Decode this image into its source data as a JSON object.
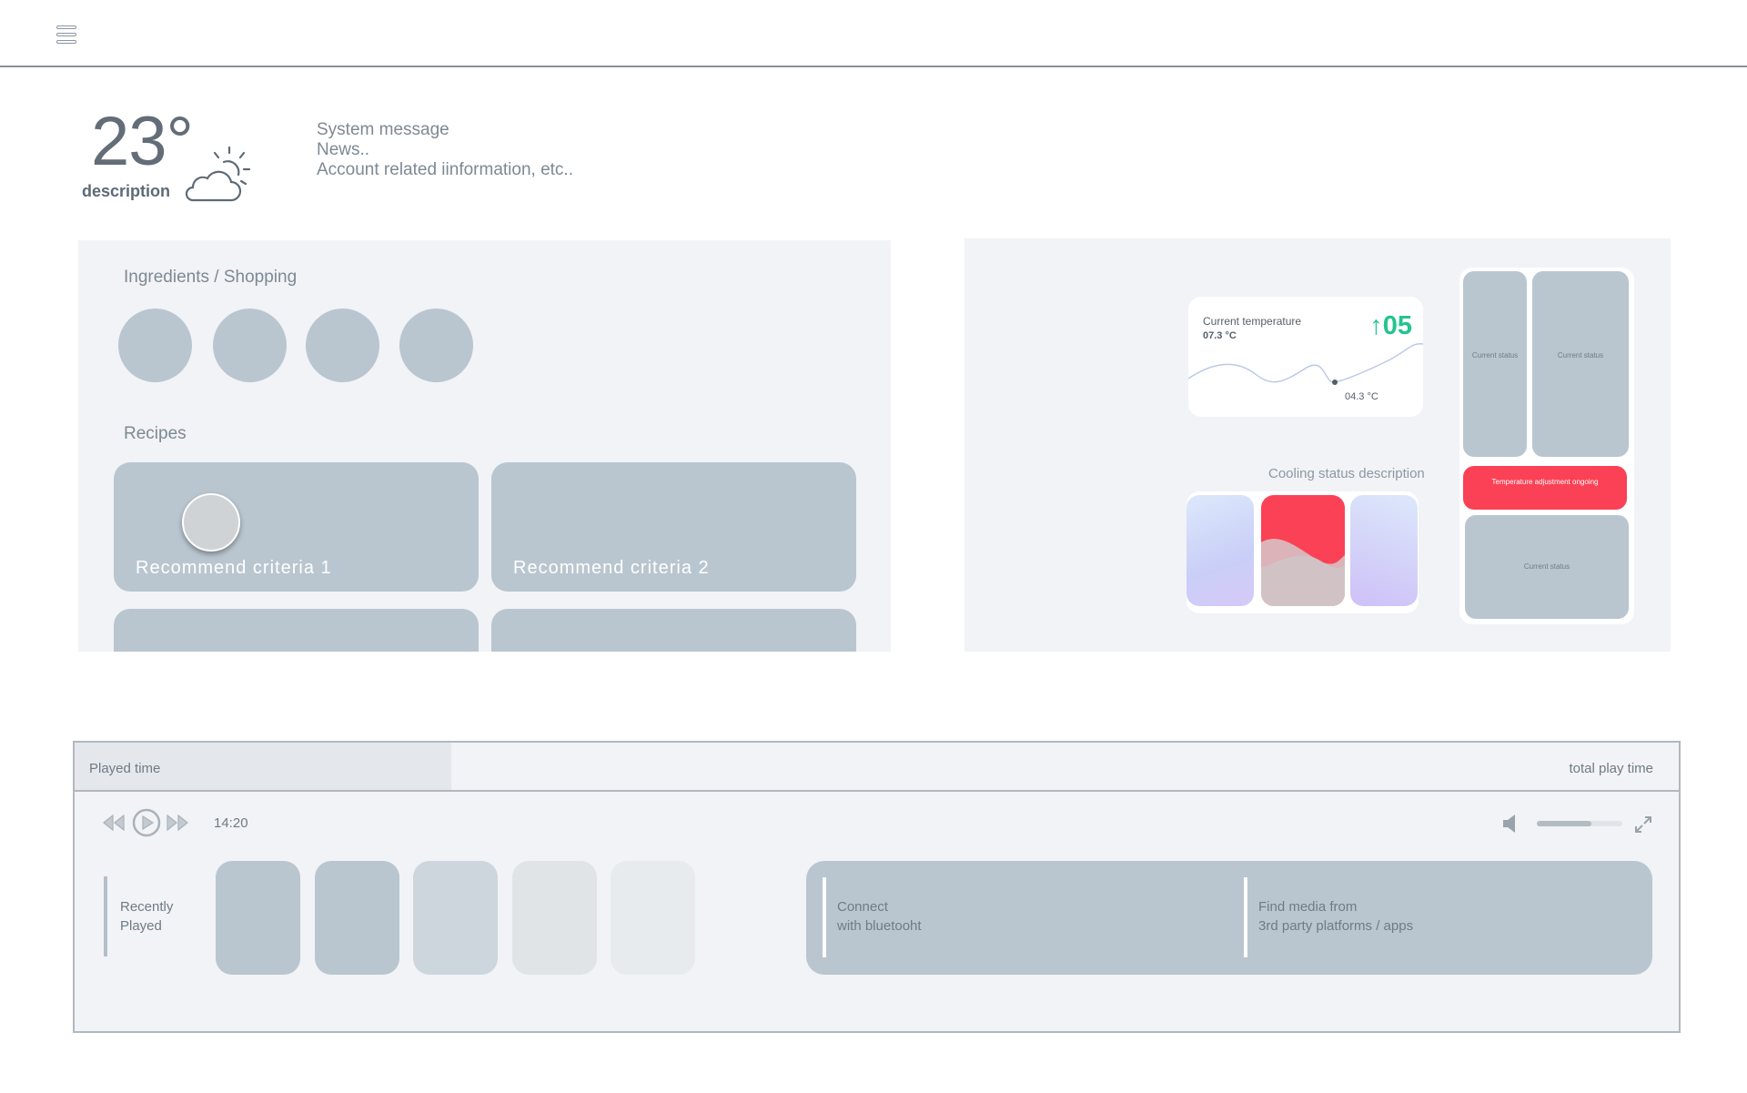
{
  "weather": {
    "temperature": "23°",
    "description": "description",
    "icon": "partly-cloudy-icon"
  },
  "messages": {
    "line1": "System message",
    "line2": "News..",
    "line3": "Account related iinformation, etc.."
  },
  "kitchen": {
    "ingredients_title": "Ingredients / Shopping",
    "recipes_title": "Recipes",
    "recipes": [
      {
        "label": "Recommend criteria 1"
      },
      {
        "label": "Recommend criteria 2"
      },
      {
        "label": ""
      },
      {
        "label": ""
      }
    ]
  },
  "fridge": {
    "temp_card": {
      "title": "Current temperature",
      "current": "07.3 °C",
      "delta": "↑05",
      "low_point": "04.3 °C"
    },
    "cooling_title": "Cooling status description",
    "status": {
      "left": "Current status",
      "right": "Current status",
      "alert": "Temperature adjustment ongoing",
      "bottom": "Current status"
    },
    "colors": {
      "accent_green": "#23c48f",
      "alert_red": "#fb4155"
    }
  },
  "player": {
    "played_label": "Played time",
    "total_label": "total play time",
    "progress": 0.235,
    "time": "14:20",
    "volume": 0.64,
    "recent_label_1": "Recently",
    "recent_label_2": "Played",
    "bluetooth_1": "Connect",
    "bluetooth_2": "with bluetooht",
    "find_media_1": "Find media from",
    "find_media_2": "3rd party platforms / apps"
  }
}
